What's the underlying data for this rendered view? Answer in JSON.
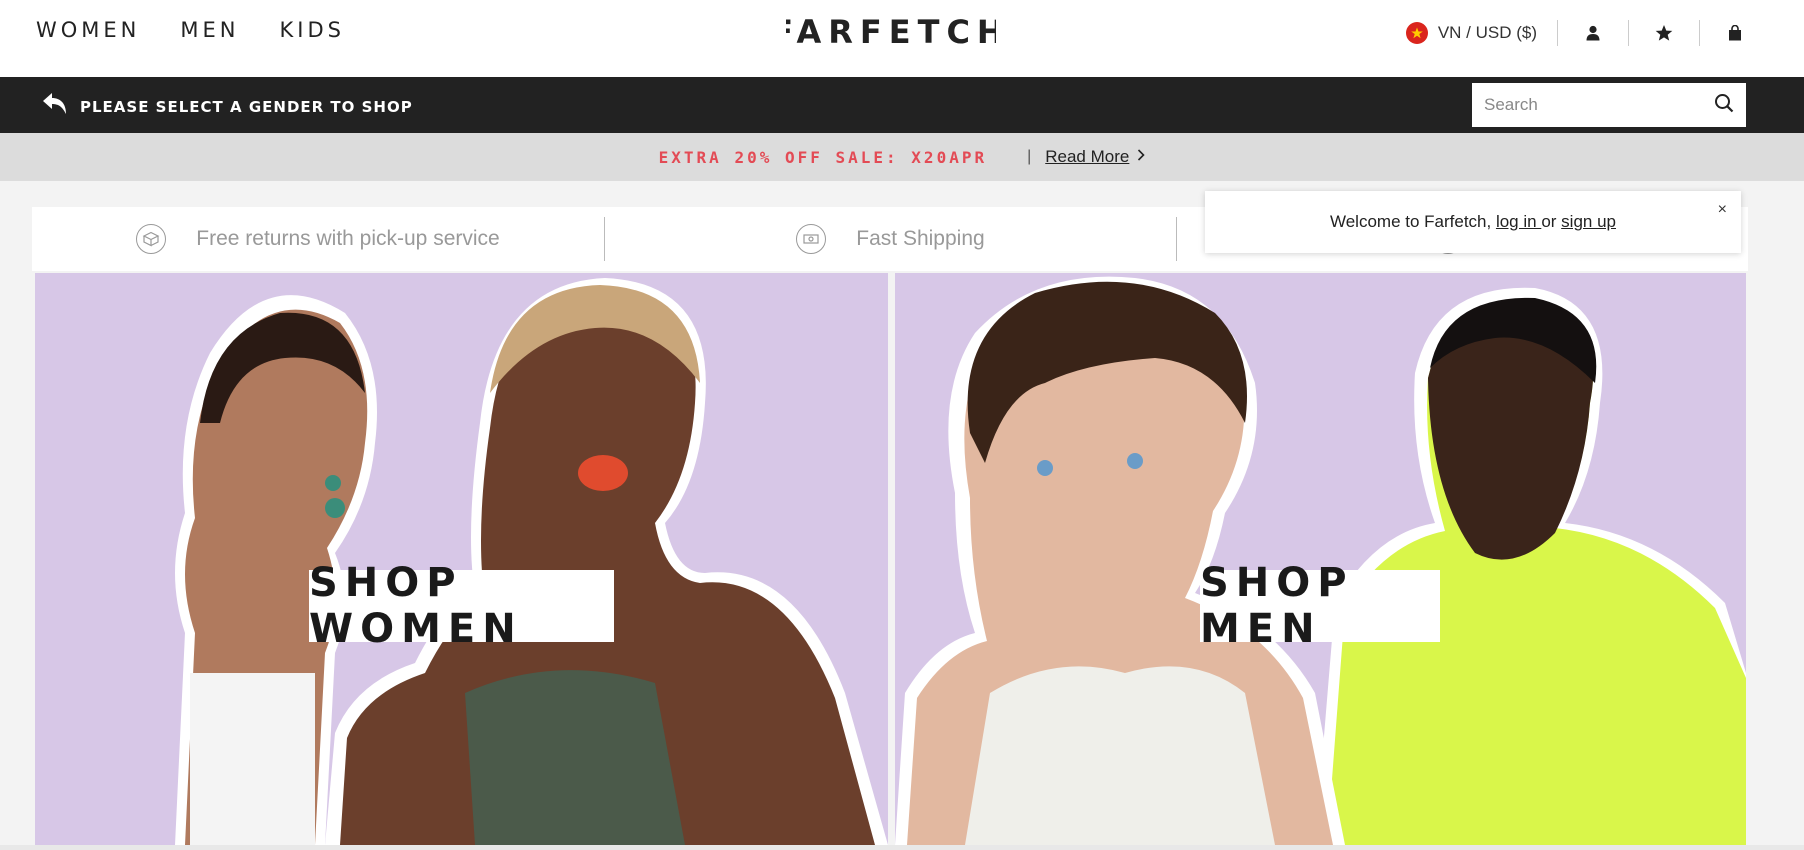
{
  "header": {
    "nav": [
      "WOMEN",
      "MEN",
      "KIDS"
    ],
    "logo_text": "FARFETCH",
    "locale": "VN / USD ($)",
    "icons": [
      "account-icon",
      "wishlist-star-icon",
      "shopping-bag-icon"
    ]
  },
  "darkbar": {
    "prompt": "PLEASE SELECT A GENDER TO SHOP",
    "search_placeholder": "Search"
  },
  "promo": {
    "code_text": "EXTRA 20% OFF SALE: X20APR",
    "separator": "|",
    "read_more": "Read More"
  },
  "benefits": [
    {
      "icon": "returns-box-icon",
      "text": "Free returns with pick-up service"
    },
    {
      "icon": "shipping-icon",
      "text": "Fast Shipping"
    },
    {
      "icon": "info-icon",
      "text": ""
    }
  ],
  "hero": {
    "women_cta": "SHOP WOMEN",
    "men_cta": "SHOP MEN"
  },
  "welcome": {
    "prefix": "Welcome to Farfetch, ",
    "login": "log in ",
    "middle": "or ",
    "signup": "sign up",
    "close": "×"
  },
  "colors": {
    "promo_red": "#e34b55",
    "hero_bg": "#d7c7e7",
    "dark_bar": "#222222"
  }
}
